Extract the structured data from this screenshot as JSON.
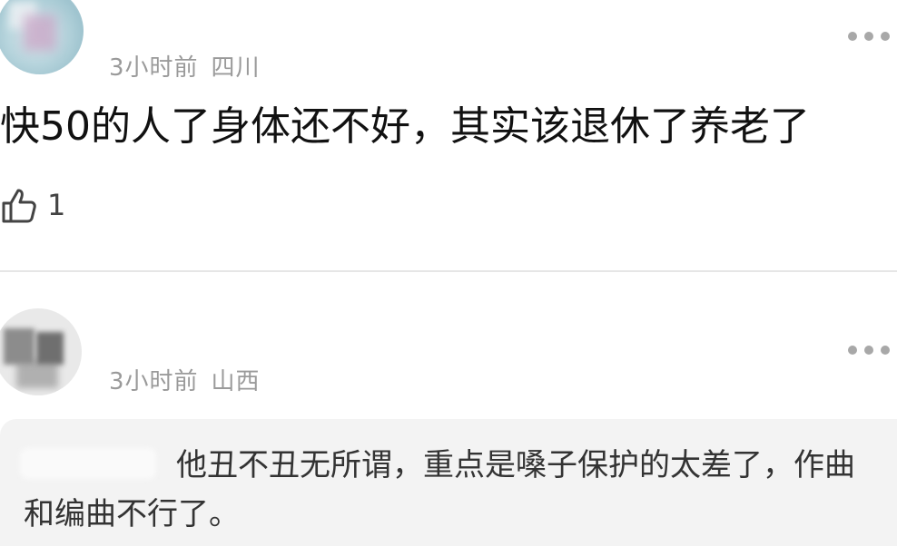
{
  "comments": [
    {
      "time": "3小时前",
      "location": "四川",
      "text": "快50的人了身体还不好，其实该退休了养老了",
      "likes": "1"
    },
    {
      "time": "3小时前",
      "location": "山西",
      "quote": "他丑不丑无所谓，重点是嗓子保护的太差了，作曲和编曲不行了。"
    }
  ],
  "icons": {
    "more": "more-dots-icon",
    "like": "thumbs-up-icon"
  },
  "colors": {
    "meta": "#9a9a9a",
    "quote_bg": "#f3f3f3",
    "divider": "#e6e6e6"
  }
}
